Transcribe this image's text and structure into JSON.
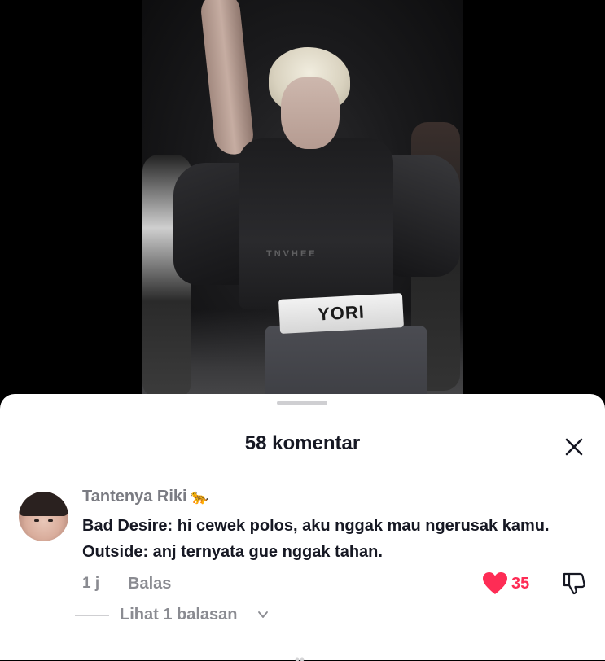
{
  "video": {
    "waistband_text": "YORI",
    "watermark": "TNVHEE"
  },
  "comments_sheet": {
    "title": "58 komentar",
    "close_icon": "close-icon"
  },
  "comment": {
    "username": "Tantenya Riki",
    "username_emoji": "🐆",
    "lines": [
      "Bad Desire: hi cewek polos, aku nggak mau ngerusak kamu.",
      "Outside: anj ternyata gue nggak tahan."
    ],
    "timestamp": "1 j",
    "reply_label": "Balas",
    "like_count": "35",
    "like_icon": "heart-icon",
    "dislike_icon": "thumbs-down-icon",
    "view_replies_label": "Lihat 1 balasan",
    "accent_color": "#fe2c55"
  }
}
